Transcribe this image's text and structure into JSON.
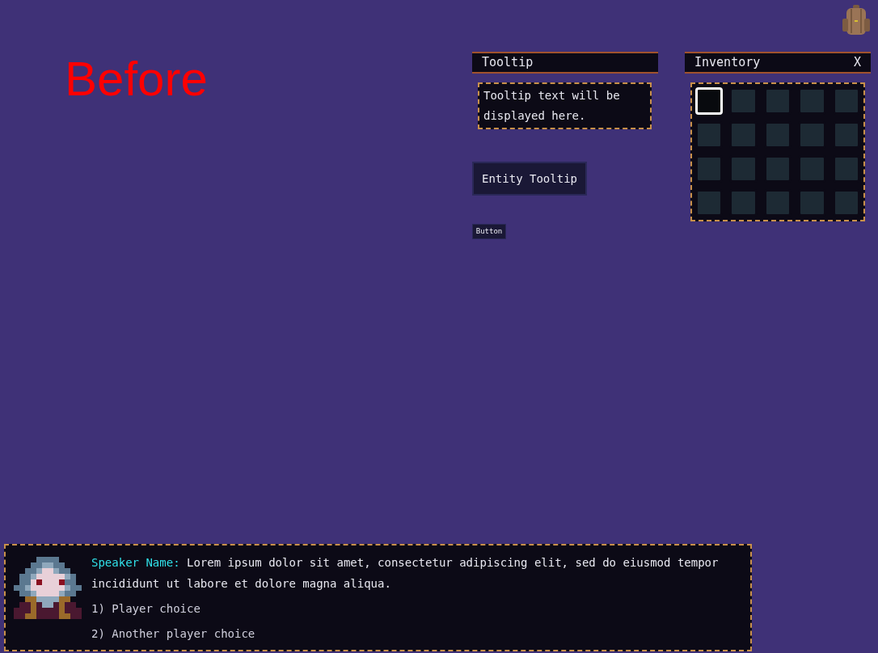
{
  "caption": "Before",
  "tooltip_window": {
    "title": "Tooltip",
    "text": "Tooltip text will be displayed here."
  },
  "entity_tooltip_button": {
    "label": "Entity Tooltip"
  },
  "small_button": {
    "label": "Button"
  },
  "inventory": {
    "title": "Inventory",
    "close": "X",
    "slots": [
      {
        "selected": true
      },
      {
        "selected": false
      },
      {
        "selected": false
      },
      {
        "selected": false
      },
      {
        "selected": false
      },
      {
        "selected": false
      },
      {
        "selected": false
      },
      {
        "selected": false
      },
      {
        "selected": false
      },
      {
        "selected": false
      },
      {
        "selected": false
      },
      {
        "selected": false
      },
      {
        "selected": false
      },
      {
        "selected": false
      },
      {
        "selected": false
      },
      {
        "selected": false
      },
      {
        "selected": false
      },
      {
        "selected": false
      },
      {
        "selected": false
      },
      {
        "selected": false
      }
    ]
  },
  "dialogue": {
    "speaker": "Speaker Name:",
    "text": "Lorem ipsum dolor sit amet, consectetur adipiscing elit, sed do eiusmod tempor incididunt ut labore et dolore magna aliqua.",
    "choices": [
      "1) Player choice",
      "2) Another player choice"
    ]
  }
}
